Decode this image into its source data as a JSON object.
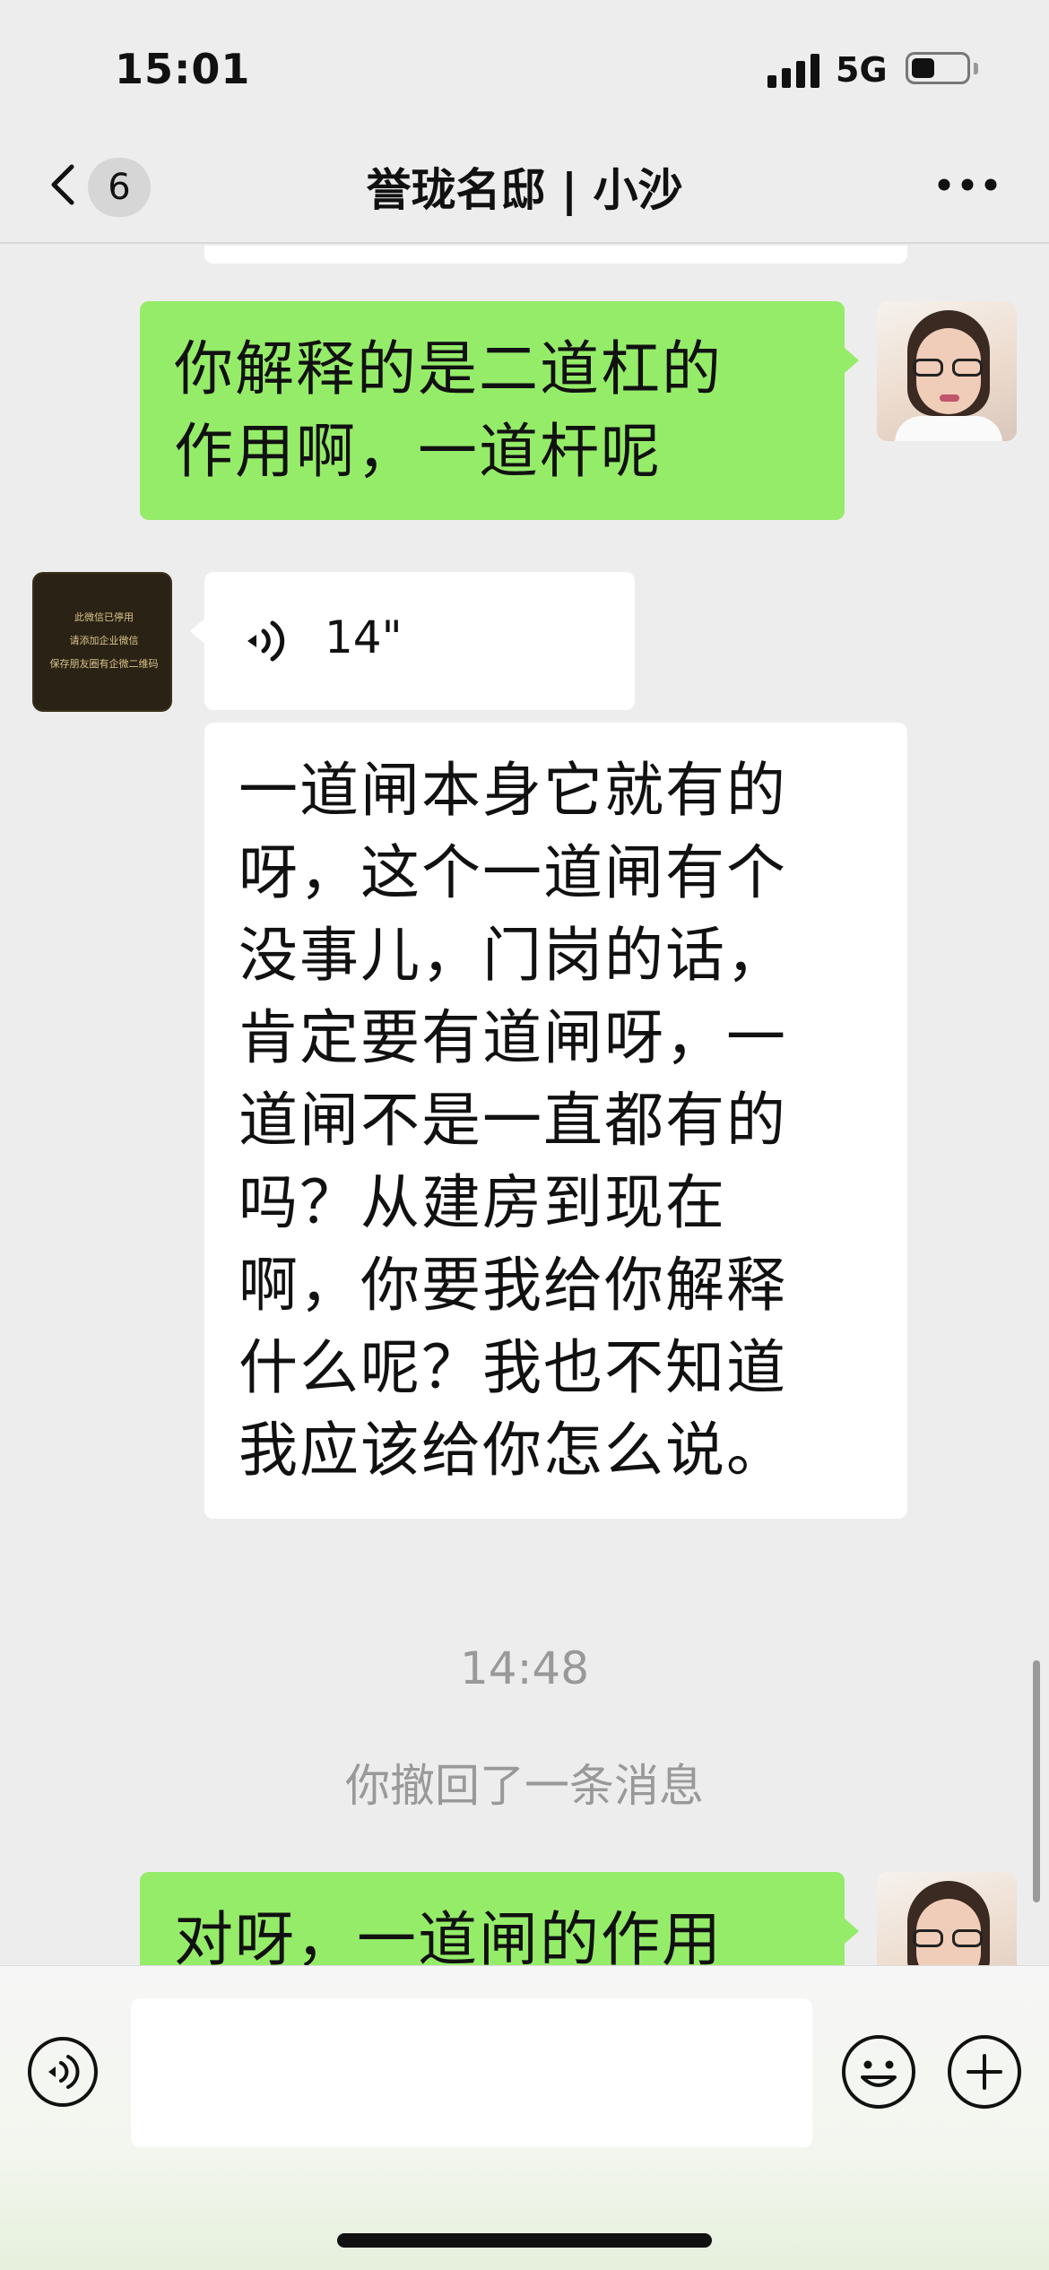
{
  "status_bar": {
    "time": "15:01",
    "network": "5G",
    "battery_level": 0.42
  },
  "nav": {
    "back_icon": "chevron-left-icon",
    "unread_count": "6",
    "title": "誉珑名邸 | 小沙",
    "more_icon": "more-dots-icon"
  },
  "messages": [
    {
      "side": "right",
      "type": "text",
      "lines": [
        "你解释的是二道杠的",
        "作用啊，一道杆呢"
      ]
    },
    {
      "side": "left",
      "type": "voice",
      "duration": "14\"",
      "icon": "voice-wave-icon"
    },
    {
      "side": "left",
      "type": "text",
      "lines": [
        "一道闸本身它就有的",
        "呀，这个一道闸有个",
        "没事儿，门岗的话，",
        "肯定要有道闸呀，一",
        "道闸不是一直都有的",
        "吗？从建房到现在",
        "啊，你要我给你解释",
        "什么呢？我也不知道",
        "我应该给你怎么说。"
      ]
    },
    {
      "type": "time",
      "text": "14:48"
    },
    {
      "type": "system",
      "text": "你撤回了一条消息"
    },
    {
      "side": "right",
      "type": "text",
      "lines": [
        "对呀，一道闸的作用"
      ]
    }
  ],
  "other_avatar_lines": [
    "此微信已停用",
    "请添加企业微信",
    "保存朋友圈有企微二维码"
  ],
  "input_bar": {
    "voice_icon": "voice-input-icon",
    "emoji_icon": "emoji-icon",
    "plus_icon": "plus-icon",
    "input_value": ""
  },
  "colors": {
    "self_bubble": "#95ec69",
    "other_bubble": "#ffffff",
    "background": "#ededed",
    "muted_text": "#999999"
  }
}
